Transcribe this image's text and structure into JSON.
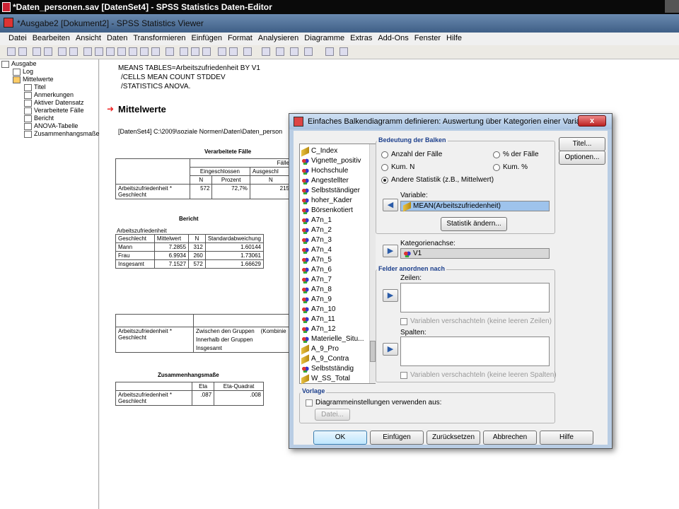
{
  "bg_window": {
    "title": "*Daten_personen.sav [DatenSet4] - SPSS Statistics Daten-Editor"
  },
  "viewer": {
    "title": "*Ausgabe2 [Dokument2] - SPSS Statistics Viewer",
    "menu": [
      "Datei",
      "Bearbeiten",
      "Ansicht",
      "Daten",
      "Transformieren",
      "Einfügen",
      "Format",
      "Analysieren",
      "Diagramme",
      "Extras",
      "Add-Ons",
      "Fenster",
      "Hilfe"
    ],
    "tree": [
      "Ausgabe",
      "Log",
      "Mittelwerte",
      "Titel",
      "Anmerkungen",
      "Aktiver Datensatz",
      "Verarbeitete Fälle",
      "Bericht",
      "ANOVA-Tabelle",
      "Zusammenhangsmaße"
    ],
    "syntax": [
      "MEANS TABLES=Arbeitszufriedenheit BY V1",
      "/CELLS MEAN COUNT STDDEV",
      "/STATISTICS ANOVA."
    ],
    "heading": "Mittelwerte",
    "dataset_line": "[DatenSet4] C:\\2009\\soziale Normen\\Daten\\Daten_person",
    "t1": {
      "title": "Verarbeitete Fälle",
      "faelle": "Fälle",
      "eing": "Eingeschlossen",
      "ausg": "Ausgeschl",
      "n": "N",
      "prozent": "Prozent",
      "row": "Arbeitszufriedenheit * Geschlecht",
      "v1": "572",
      "v2": "72,7%",
      "v3": "215"
    },
    "t2": {
      "title": "Bericht",
      "sub": "Arbeitszufriedenheit",
      "c0": "Geschlecht",
      "c1": "Mittelwert",
      "c2": "N",
      "c3": "Standardabweichung",
      "rows": [
        [
          "Mann",
          "7.2855",
          "312",
          "1.60144"
        ],
        [
          "Frau",
          "6.9934",
          "260",
          "1.73061"
        ],
        [
          "Insgesamt",
          "7.1527",
          "572",
          "1.66629"
        ]
      ]
    },
    "t3": {
      "row": "Arbeitszufriedenheit * Geschlecht",
      "a": "Zwischen den Gruppen",
      "a2": "(Kombinie",
      "b": "Innerhalb der Gruppen",
      "c": "Insgesamt"
    },
    "t4": {
      "title": "Zusammenhangsmaße",
      "c1": "Eta",
      "c2": "Eta-Quadrat",
      "row": "Arbeitszufriedenheit * Geschlecht",
      "v1": ".087",
      "v2": ".008"
    }
  },
  "dialog": {
    "title": "Einfaches Balkendiagramm definieren: Auswertung über Kategorien einer Variablen",
    "close": "x",
    "variables": [
      {
        "name": "C_Index",
        "icon": "ruler"
      },
      {
        "name": "Vignette_positiv",
        "icon": "scale"
      },
      {
        "name": "Hochschule",
        "icon": "scale"
      },
      {
        "name": "Angestellter",
        "icon": "scale"
      },
      {
        "name": "Selbstständiger",
        "icon": "scale"
      },
      {
        "name": "hoher_Kader",
        "icon": "scale"
      },
      {
        "name": "Börsenkotiert",
        "icon": "scale"
      },
      {
        "name": "A7n_1",
        "icon": "scale"
      },
      {
        "name": "A7n_2",
        "icon": "scale"
      },
      {
        "name": "A7n_3",
        "icon": "scale"
      },
      {
        "name": "A7n_4",
        "icon": "scale"
      },
      {
        "name": "A7n_5",
        "icon": "scale"
      },
      {
        "name": "A7n_6",
        "icon": "scale"
      },
      {
        "name": "A7n_7",
        "icon": "scale"
      },
      {
        "name": "A7n_8",
        "icon": "scale"
      },
      {
        "name": "A7n_9",
        "icon": "scale"
      },
      {
        "name": "A7n_10",
        "icon": "scale"
      },
      {
        "name": "A7n_11",
        "icon": "scale"
      },
      {
        "name": "A7n_12",
        "icon": "scale"
      },
      {
        "name": "Materielle_Situ...",
        "icon": "scale"
      },
      {
        "name": "A_9_Pro",
        "icon": "ruler"
      },
      {
        "name": "A_9_Contra",
        "icon": "ruler"
      },
      {
        "name": "Selbstständig",
        "icon": "scale"
      },
      {
        "name": "W_SS_Total",
        "icon": "ruler"
      }
    ],
    "bars_group": "Bedeutung der Balken",
    "radio_n": "Anzahl der Fälle",
    "radio_pct": "% der Fälle",
    "radio_kumn": "Kum. N",
    "radio_kumpct": "Kum. %",
    "radio_other": "Andere Statistik (z.B., Mittelwert)",
    "variable_label": "Variable:",
    "variable_value": "MEAN(Arbeitszufriedenheit)",
    "statistik_btn": "Statistik ändern...",
    "kat_label": "Kategorienachse:",
    "kat_value": "V1",
    "felder_group": "Felder anordnen nach",
    "zeilen": "Zeilen:",
    "nest_rows": "Variablen verschachteln (keine leeren Zeilen)",
    "spalten": "Spalten:",
    "nest_cols": "Variablen verschachteln (keine leeren Spalten)",
    "vorlage_group": "Vorlage",
    "vorlage_chk": "Diagrammeinstellungen verwenden aus:",
    "datei_btn": "Datei...",
    "titel_btn": "Titel...",
    "optionen_btn": "Optionen...",
    "ok": "OK",
    "einfuegen": "Einfügen",
    "zuruecksetzen": "Zurücksetzen",
    "abbrechen": "Abbrechen",
    "hilfe": "Hilfe"
  },
  "colors": {
    "accent": "#1c3f8c",
    "selection": "#9ec3ec",
    "dialog_frame": "#b9cde4"
  }
}
